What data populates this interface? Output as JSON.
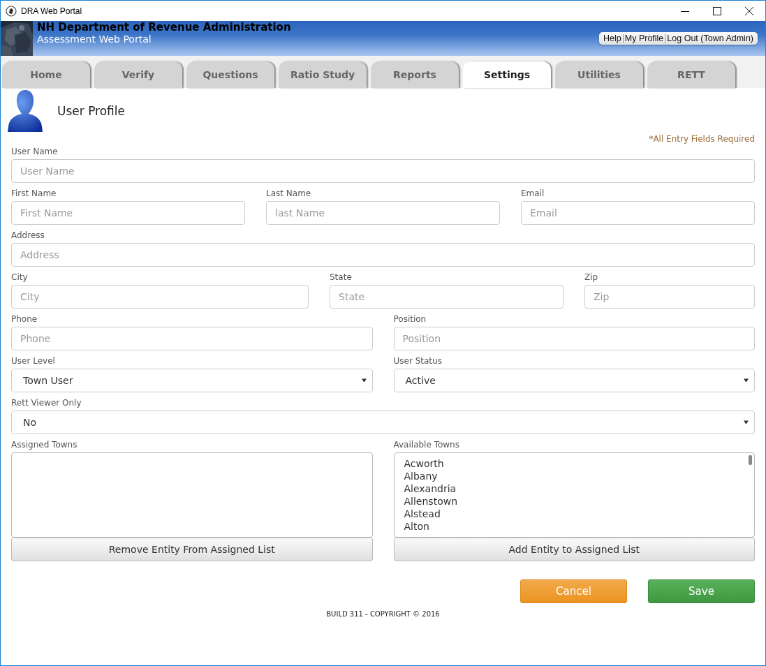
{
  "window": {
    "title": "DRA Web Portal"
  },
  "header": {
    "title": "NH Department of Revenue Administration",
    "subtitle": "Assessment Web Portal",
    "links": [
      "Help",
      "My Profile",
      "Log Out (Town Admin)"
    ]
  },
  "tabs": [
    {
      "label": "Home",
      "selected": false
    },
    {
      "label": "Verify",
      "selected": false
    },
    {
      "label": "Questions",
      "selected": false
    },
    {
      "label": "Ratio Study",
      "selected": false
    },
    {
      "label": "Reports",
      "selected": false
    },
    {
      "label": "Settings",
      "selected": true
    },
    {
      "label": "Utilities",
      "selected": false
    },
    {
      "label": "RETT",
      "selected": false
    }
  ],
  "page": {
    "title": "User Profile",
    "required_note": "*All Entry Fields Required"
  },
  "form": {
    "rows": [
      {
        "fields": [
          {
            "label": "User Name",
            "kind": "input",
            "placeholder": "User Name"
          }
        ]
      },
      {
        "fields": [
          {
            "label": "First Name",
            "kind": "input",
            "placeholder": "First Name"
          },
          {
            "label": "Last Name",
            "kind": "input",
            "placeholder": "last Name"
          },
          {
            "label": "Email",
            "kind": "input",
            "placeholder": "Email"
          }
        ]
      },
      {
        "fields": [
          {
            "label": "Address",
            "kind": "input",
            "placeholder": "Address"
          }
        ]
      },
      {
        "fields": [
          {
            "label": "City",
            "kind": "input",
            "placeholder": "City"
          },
          {
            "label": "State",
            "kind": "input",
            "placeholder": "State"
          },
          {
            "label": "Zip",
            "kind": "input",
            "placeholder": "Zip"
          }
        ]
      },
      {
        "fields": [
          {
            "label": "Phone",
            "kind": "input",
            "placeholder": "Phone"
          },
          {
            "label": "Position",
            "kind": "input",
            "placeholder": "Position"
          }
        ]
      },
      {
        "fields": [
          {
            "label": "User Level",
            "kind": "select",
            "value": "Town User"
          },
          {
            "label": "User Status",
            "kind": "select",
            "value": "Active"
          }
        ]
      },
      {
        "fields": [
          {
            "label": "Rett Viewer Only",
            "kind": "select",
            "value": "No"
          }
        ]
      },
      {
        "fields": [
          {
            "label": "Assigned Towns",
            "kind": "listbox",
            "button": "Remove Entity From Assigned List"
          },
          {
            "label": "Available Towns",
            "kind": "listbox",
            "items": [
              "Acworth",
              "Albany",
              "Alexandria",
              "Allenstown",
              "Alstead",
              "Alton"
            ],
            "button": "Add Entity to Assigned List"
          }
        ]
      }
    ]
  },
  "actions": [
    {
      "label": "Cancel",
      "kind": "cancel"
    },
    {
      "label": "Save",
      "kind": "save"
    }
  ],
  "footer": "BUILD 311 - COPYRIGHT © 2016"
}
